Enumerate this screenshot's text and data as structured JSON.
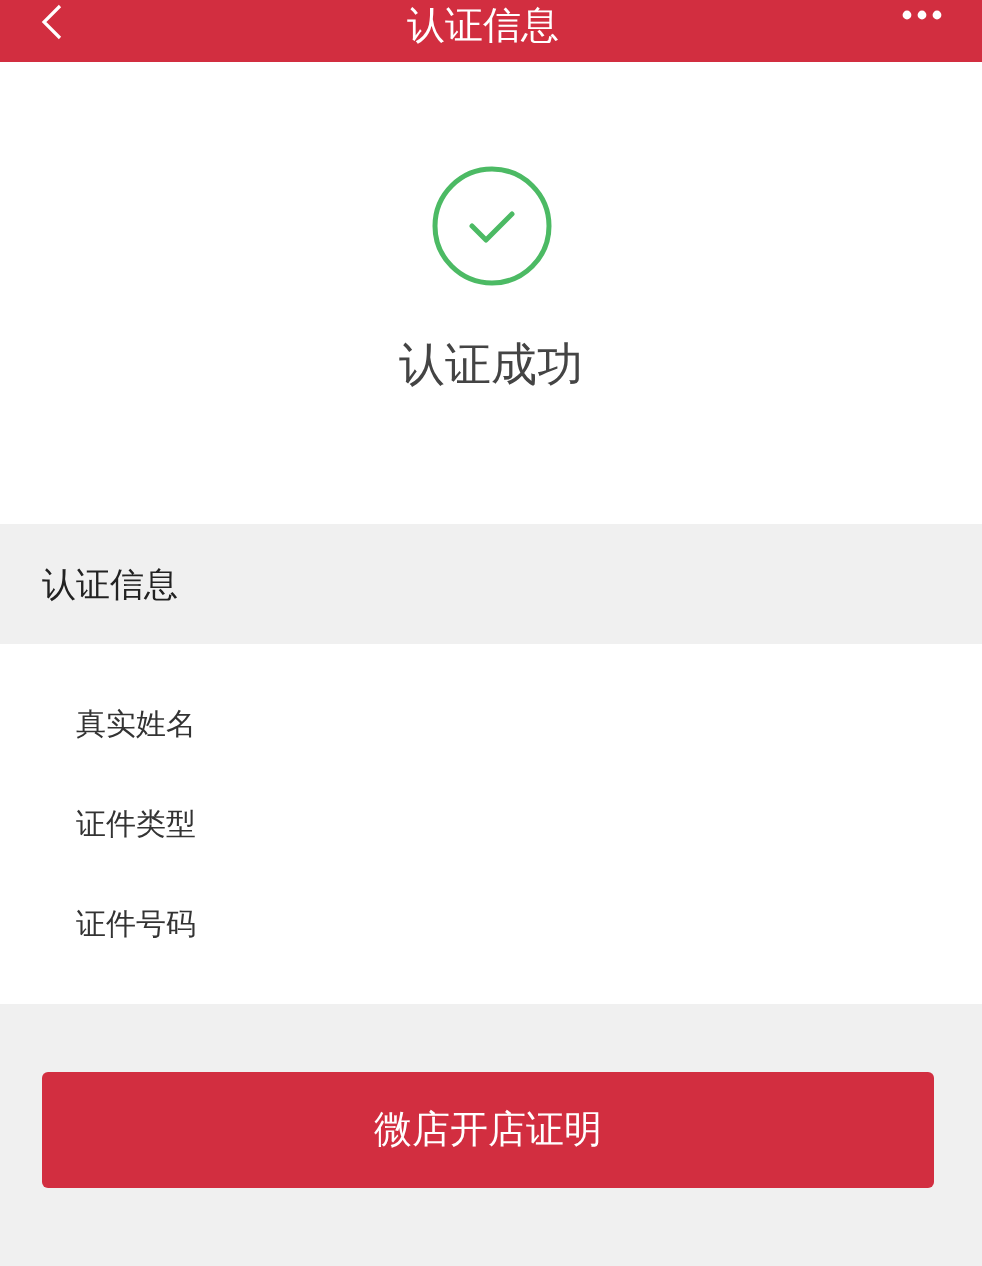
{
  "header": {
    "title": "认证信息"
  },
  "status": {
    "message": "认证成功"
  },
  "section": {
    "title": "认证信息"
  },
  "rows": [
    {
      "label": "真实姓名"
    },
    {
      "label": "证件类型"
    },
    {
      "label": "证件号码"
    }
  ],
  "button": {
    "label": "微店开店证明"
  }
}
